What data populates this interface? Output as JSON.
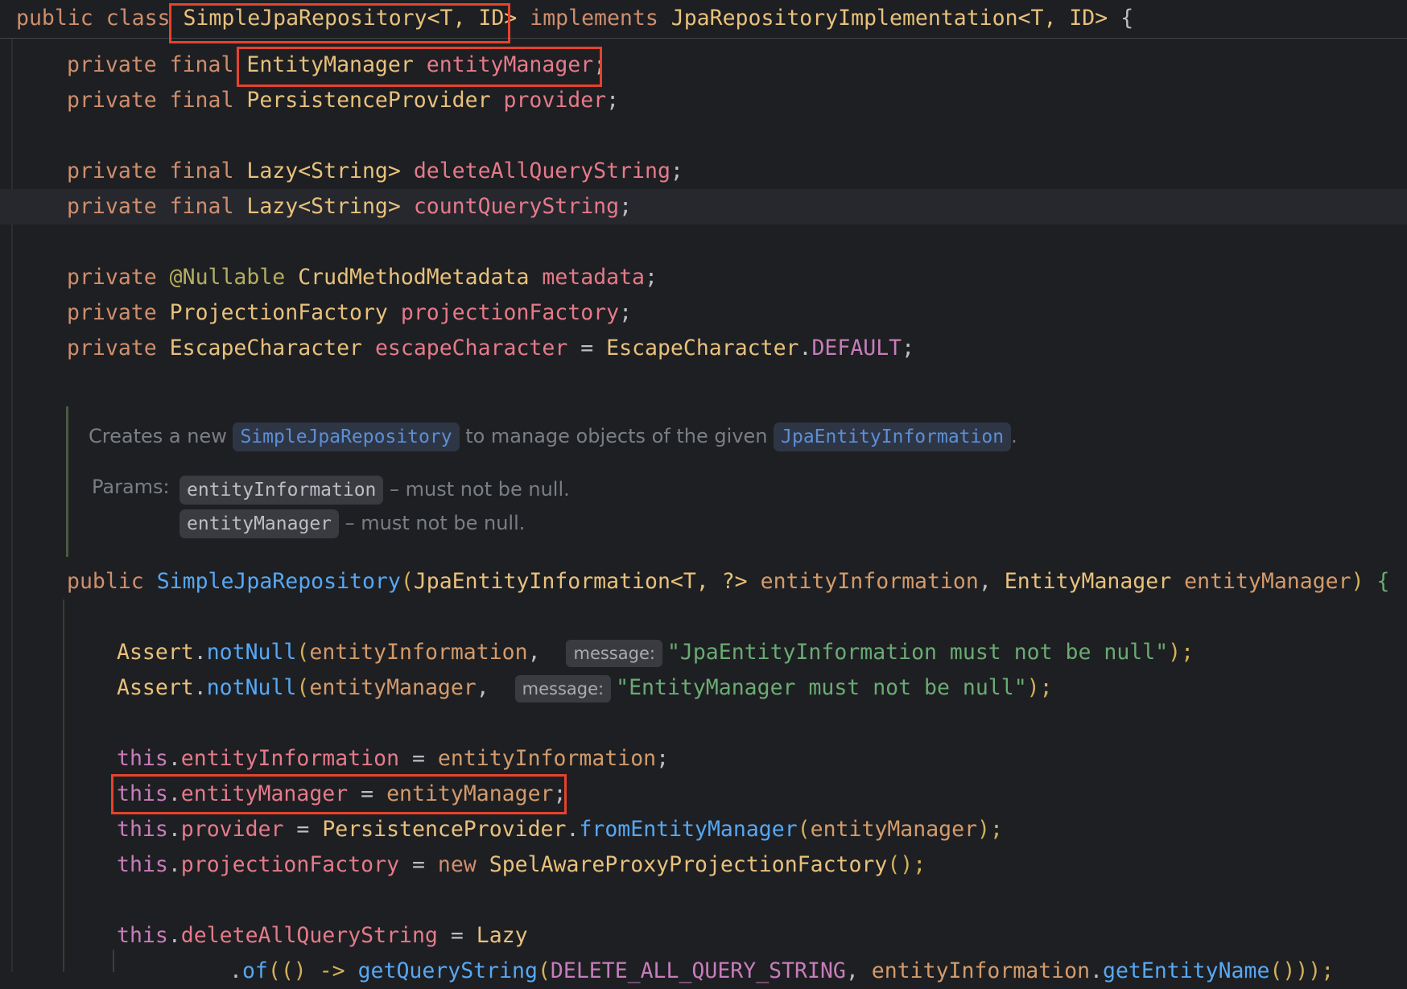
{
  "sticky_header": {
    "kw_public": "public",
    "kw_class": "class",
    "class_name": "SimpleJpaRepository<T, ID>",
    "kw_implements": "implements",
    "interface": "JpaRepositoryImplementation<T, ID>",
    "brace": "{"
  },
  "fields": [
    {
      "mods": "private final",
      "type": "EntityManager",
      "name": "entityManager",
      "end": ";"
    },
    {
      "mods": "private final",
      "type": "PersistenceProvider",
      "name": "provider",
      "end": ";"
    },
    {
      "mods": "private final",
      "type": "Lazy<String>",
      "name": "deleteAllQueryString",
      "end": ";"
    },
    {
      "mods": "private final",
      "type": "Lazy<String>",
      "name": "countQueryString",
      "end": ";"
    },
    {
      "mods": "private",
      "ann": "@Nullable",
      "type": "CrudMethodMetadata",
      "name": "metadata",
      "end": ";"
    },
    {
      "mods": "private",
      "type": "ProjectionFactory",
      "name": "projectionFactory",
      "end": ";"
    },
    {
      "mods": "private",
      "type": "EscapeCharacter",
      "name": "escapeCharacter",
      "eq": " = ",
      "rhs_type": "EscapeCharacter",
      "dot": ".",
      "rhs_const": "DEFAULT",
      "end": ";"
    }
  ],
  "doc": {
    "lead": "Creates a new ",
    "chip1": "SimpleJpaRepository",
    "middle": " to manage objects of the given ",
    "chip2": "JpaEntityInformation",
    "tail": ".",
    "params_label": "Params:",
    "param1": "entityInformation",
    "param1_desc": "– must not be null.",
    "param2": "entityManager",
    "param2_desc": "– must not be null."
  },
  "ctor": {
    "kw": "public",
    "name": "SimpleJpaRepository",
    "open": "(",
    "p1_type": "JpaEntityInformation<T, ?>",
    "p1_name": "entityInformation",
    "comma": ", ",
    "p2_type": "EntityManager",
    "p2_name": "entityManager",
    "close": ")",
    "brace": "{"
  },
  "asserts": [
    {
      "cls": "Assert",
      "dot": ".",
      "fn": "notNull",
      "open": "(",
      "arg": "entityInformation",
      "comma": ",",
      "hint": "message:",
      "str": "\"JpaEntityInformation must not be null\"",
      "end": ");"
    },
    {
      "cls": "Assert",
      "dot": ".",
      "fn": "notNull",
      "open": "(",
      "arg": "entityManager",
      "comma": ",",
      "hint": "message:",
      "str": "\"EntityManager must not be null\"",
      "end": ");"
    }
  ],
  "assigns": {
    "a1": {
      "this": "this",
      "dot": ".",
      "field": "entityInformation",
      "eq": " = ",
      "rhs": "entityInformation",
      "end": ";"
    },
    "a2": {
      "this": "this",
      "dot": ".",
      "field": "entityManager",
      "eq": " = ",
      "rhs": "entityManager",
      "end": ";"
    },
    "a3": {
      "this": "this",
      "dot": ".",
      "field": "provider",
      "eq": " = ",
      "cls": "PersistenceProvider",
      "dot2": ".",
      "fn": "fromEntityManager",
      "open": "(",
      "arg": "entityManager",
      "end": ");"
    },
    "a4": {
      "this": "this",
      "dot": ".",
      "field": "projectionFactory",
      "eq": " = ",
      "kw": "new",
      "cls": "SpelAwareProxyProjectionFactory",
      "end": "();"
    },
    "a5": {
      "this": "this",
      "dot": ".",
      "field": "deleteAllQueryString",
      "eq": " = ",
      "cls": "Lazy"
    },
    "a6": {
      "fn1": "of",
      "open": "(() -> ",
      "fn2": "getQueryString",
      "open2": "(",
      "cst": "DELETE_ALL_QUERY_STRING",
      "comma": ", ",
      "arg": "entityInformation",
      "dot": ".",
      "fn3": "getEntityName",
      "end": "()));"
    }
  }
}
